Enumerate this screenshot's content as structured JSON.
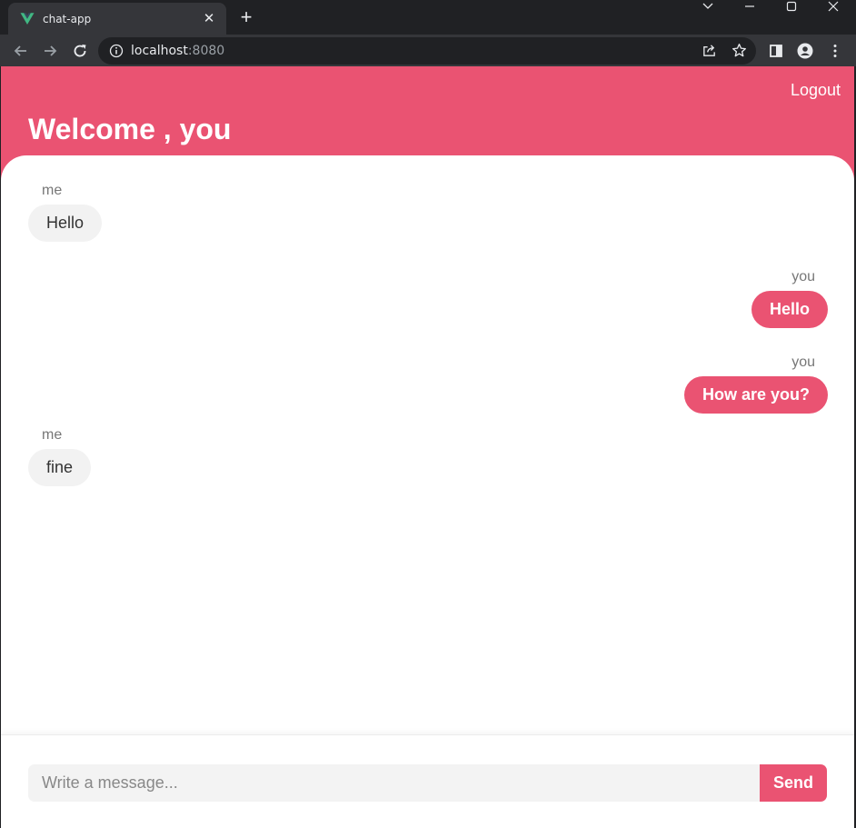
{
  "browser": {
    "tab_title": "chat-app",
    "tab_close": "✕",
    "new_tab": "+",
    "url_host": "localhost",
    "url_port": ":8080"
  },
  "app": {
    "logout_label": "Logout",
    "welcome_text": "Welcome , you",
    "accent_color": "#ea5372"
  },
  "messages": [
    {
      "sender": "me",
      "text": "Hello"
    },
    {
      "sender": "you",
      "text": "Hello"
    },
    {
      "sender": "you",
      "text": "How are you?"
    },
    {
      "sender": "me",
      "text": "fine"
    }
  ],
  "composer": {
    "placeholder": "Write a message...",
    "send_label": "Send"
  }
}
